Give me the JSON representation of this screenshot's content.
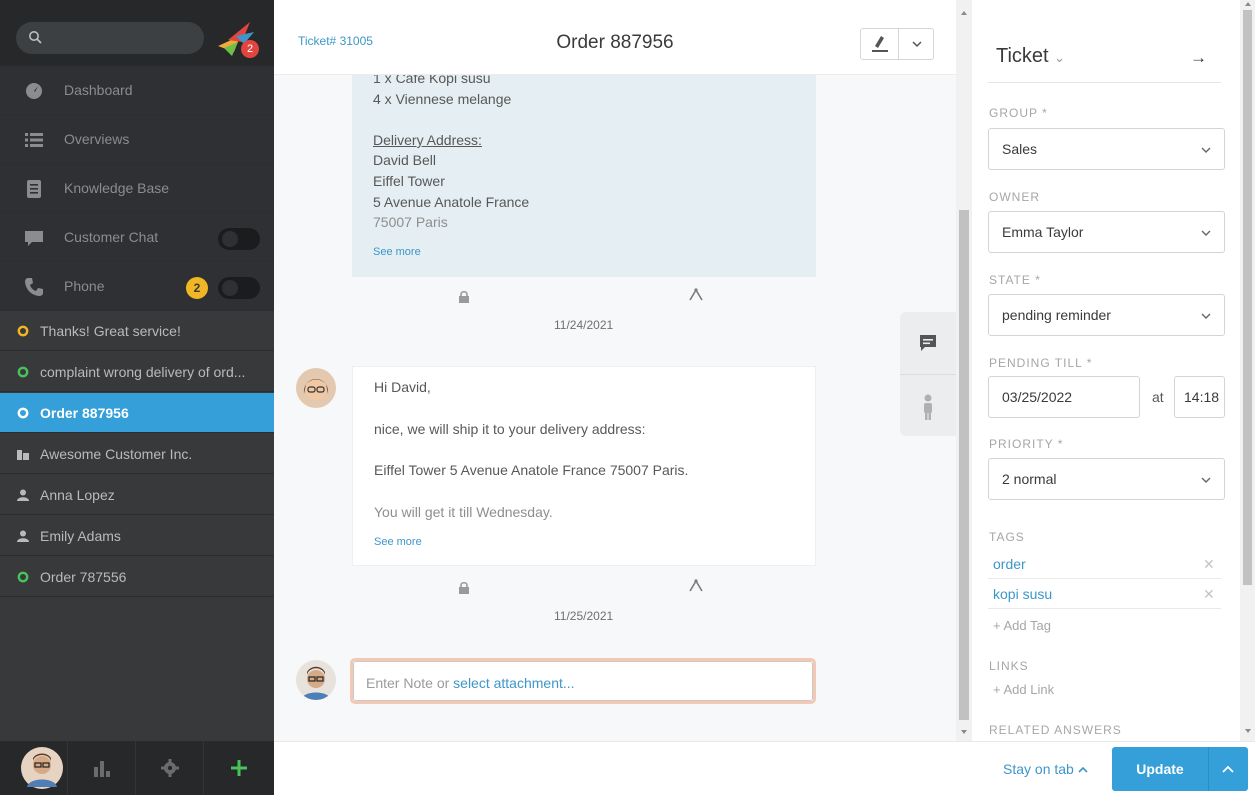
{
  "sidebar": {
    "logo_badge": "2",
    "nav": [
      {
        "label": "Dashboard",
        "icon": "dashboard-icon"
      },
      {
        "label": "Overviews",
        "icon": "overviews-icon"
      },
      {
        "label": "Knowledge Base",
        "icon": "knowledge-base-icon"
      },
      {
        "label": "Customer Chat",
        "icon": "chat-icon"
      },
      {
        "label": "Phone",
        "icon": "phone-icon",
        "badge": "2"
      }
    ],
    "tasks": [
      {
        "label": "Thanks! Great service!",
        "icon": "ring-yellow-icon"
      },
      {
        "label": "complaint wrong delivery of ord...",
        "icon": "ring-green-icon"
      },
      {
        "label": "Order 887956",
        "icon": "ring-white-icon"
      },
      {
        "label": "Awesome Customer Inc.",
        "icon": "organization-icon"
      },
      {
        "label": "Anna Lopez",
        "icon": "user-icon"
      },
      {
        "label": "Emily Adams",
        "icon": "user-icon"
      },
      {
        "label": "Order 787556",
        "icon": "ring-green-icon"
      }
    ]
  },
  "header": {
    "ticket_number": "Ticket# 31005",
    "title": "Order 887956"
  },
  "articles": {
    "first": {
      "lines": [
        "1 x Cafe Kopi susu",
        "4 x Viennese melange",
        "Delivery Address:",
        "David Bell",
        "Eiffel Tower",
        "5 Avenue Anatole France",
        "75007 Paris"
      ],
      "see_more": "See more",
      "date": "11/24/2021"
    },
    "second": {
      "lines": [
        "Hi David,",
        "nice, we will ship it to your delivery address:",
        "Eiffel Tower 5 Avenue Anatole France 75007 Paris.",
        "You will get it till Wednesday."
      ],
      "see_more": "See more",
      "date": "11/25/2021"
    }
  },
  "note": {
    "placeholder": "Enter Note or ",
    "link": "select attachment..."
  },
  "panel": {
    "title": "Ticket",
    "group_label": "GROUP *",
    "group_value": "Sales",
    "owner_label": "OWNER",
    "owner_value": "Emma Taylor",
    "state_label": "STATE *",
    "state_value": "pending reminder",
    "pending_label": "PENDING TILL *",
    "pending_date": "03/25/2022",
    "pending_at": "at",
    "pending_time": "14:18",
    "priority_label": "PRIORITY *",
    "priority_value": "2 normal",
    "tags_label": "TAGS",
    "tags": [
      "order",
      "kopi susu"
    ],
    "add_tag": "+ Add Tag",
    "links_label": "LINKS",
    "add_link": "+ Add Link",
    "related_label": "RELATED ANSWERS"
  },
  "bottom": {
    "stay_on_tab": "Stay on tab",
    "update": "Update"
  },
  "colors": {
    "sidebar": "#38393b",
    "accent": "#349fd9",
    "article_bg": "#e4eef3",
    "link": "#3c97c8"
  }
}
